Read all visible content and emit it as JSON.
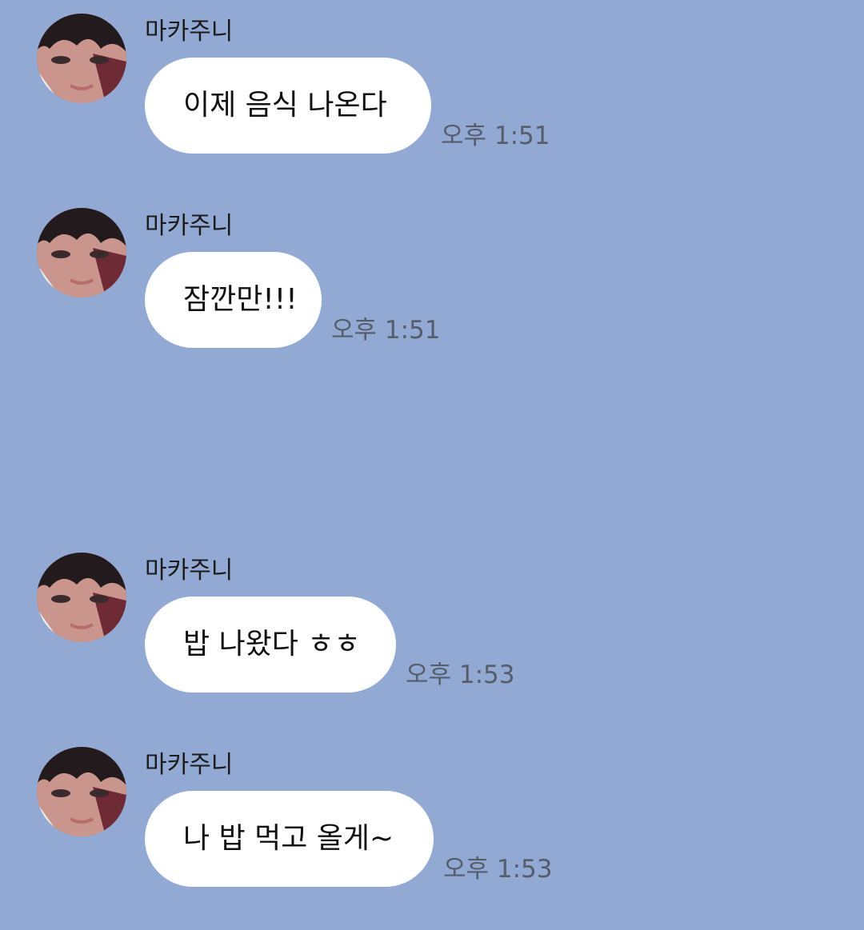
{
  "colors": {
    "background": "#92a9d4",
    "bubble": "#ffffff",
    "time_text": "#555d6b",
    "sender_text": "#1b1b1b"
  },
  "messages": [
    {
      "sender": "마카주니",
      "text": "이제 음식 나온다",
      "time": "오후 1:51",
      "avatar_icon": "profile-photo"
    },
    {
      "sender": "마카주니",
      "text": "잠깐만!!!",
      "time": "오후 1:51",
      "avatar_icon": "profile-photo"
    },
    {
      "sender": "마카주니",
      "text": "밥 나왔다 ㅎㅎ",
      "time": "오후 1:53",
      "avatar_icon": "profile-photo"
    },
    {
      "sender": "마카주니",
      "text": "나 밥 먹고 올게~",
      "time": "오후 1:53",
      "avatar_icon": "profile-photo"
    }
  ]
}
